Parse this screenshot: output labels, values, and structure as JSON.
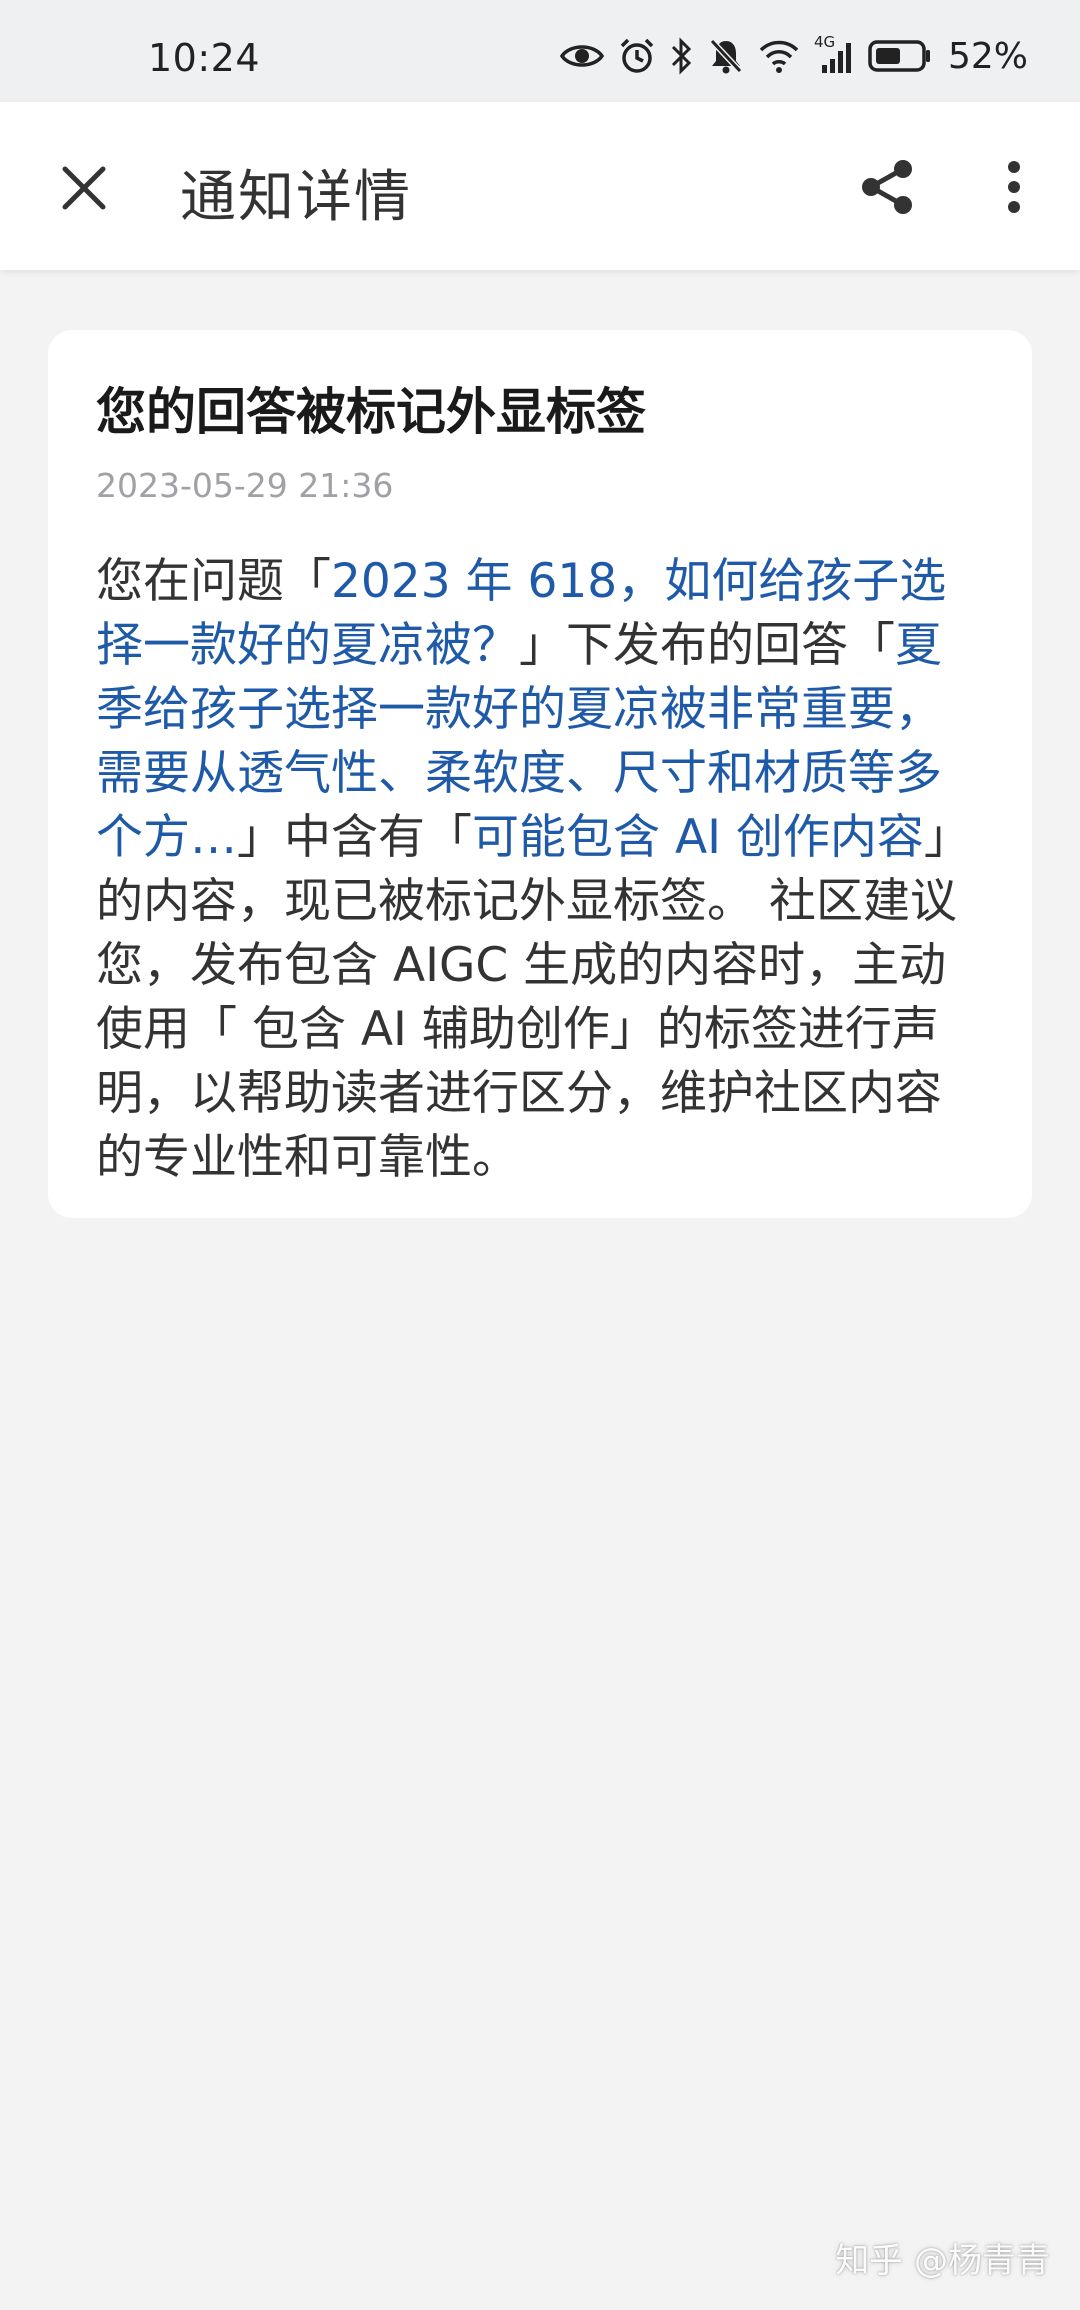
{
  "status_bar": {
    "time": "10:24",
    "icons": [
      "eye-icon",
      "alarm-icon",
      "bluetooth-icon",
      "mute-bell-icon",
      "wifi-icon",
      "signal-icon",
      "battery-icon"
    ],
    "network_label": "4G",
    "battery": "52%"
  },
  "app_bar": {
    "title": "通知详情",
    "close_icon": "close-icon",
    "share_icon": "share-icon",
    "more_icon": "more-vertical-icon"
  },
  "notification": {
    "title": "您的回答被标记外显标签",
    "timestamp": "2023-05-29 21:36",
    "body": [
      {
        "text": "您在问题「",
        "link": false
      },
      {
        "text": "2023 年 618，如何给孩子选择一款好的夏凉被？",
        "link": true
      },
      {
        "text": "」下发布的回答「",
        "link": false
      },
      {
        "text": "夏季给孩子选择一款好的夏凉被非常重要，需要从透气性、柔软度、尺寸和材质等多个方…",
        "link": true
      },
      {
        "text": "」中含有「",
        "link": false
      },
      {
        "text": "可能包含 AI 创作内容",
        "link": true
      },
      {
        "text": "」的内容，现已被标记外显标签。 社区建议您，发布包含 AIGC 生成的内容时，主动使用「 包含 AI 辅助创作」的标签进行声明，以帮助读者进行区分，维护社区内容的专业性和可靠性。",
        "link": false
      }
    ]
  },
  "watermark": "知乎 @杨青青",
  "colors": {
    "link": "#1f5aa8",
    "background": "#f3f3f4",
    "card": "#ffffff",
    "timestamp": "#a0a0a5"
  }
}
